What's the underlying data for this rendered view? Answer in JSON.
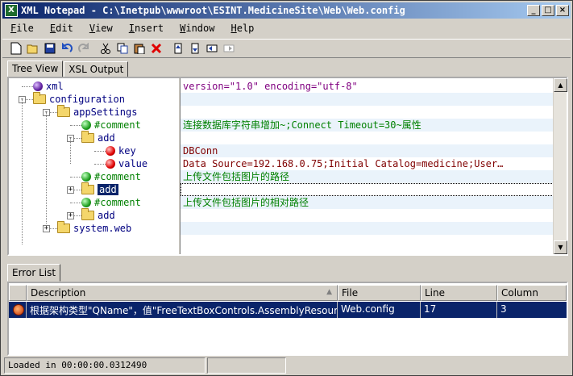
{
  "window": {
    "title": "XML Notepad - C:\\Inetpub\\wwwroot\\ESINT.MedicineSite\\Web\\Web.config",
    "app_icon": "X"
  },
  "menu": [
    "File",
    "Edit",
    "View",
    "Insert",
    "Window",
    "Help"
  ],
  "toolbar": {
    "icons": [
      "new-icon",
      "open-icon",
      "save-icon",
      "undo-icon",
      "redo-icon",
      "cut-icon",
      "copy-icon",
      "paste-icon",
      "delete-icon",
      "nudge-up-icon",
      "nudge-down-icon",
      "nudge-left-icon",
      "nudge-right-icon"
    ]
  },
  "tabs": [
    "Tree View",
    "XSL Output"
  ],
  "tree": [
    {
      "label": "xml",
      "icon": "purple-ball",
      "depth": 0,
      "exp": ""
    },
    {
      "label": "configuration",
      "icon": "folder",
      "depth": 0,
      "exp": "-"
    },
    {
      "label": "appSettings",
      "icon": "folder",
      "depth": 1,
      "exp": "-"
    },
    {
      "label": "#comment",
      "icon": "green-ball",
      "depth": 2,
      "exp": ""
    },
    {
      "label": "add",
      "icon": "folder",
      "depth": 2,
      "exp": "-"
    },
    {
      "label": "key",
      "icon": "red-ball",
      "depth": 3,
      "exp": ""
    },
    {
      "label": "value",
      "icon": "red-ball",
      "depth": 3,
      "exp": ""
    },
    {
      "label": "#comment",
      "icon": "green-ball",
      "depth": 2,
      "exp": ""
    },
    {
      "label": "add",
      "icon": "folder",
      "depth": 2,
      "exp": "+",
      "selected": true
    },
    {
      "label": "#comment",
      "icon": "green-ball",
      "depth": 2,
      "exp": ""
    },
    {
      "label": "add",
      "icon": "folder",
      "depth": 2,
      "exp": "+"
    },
    {
      "label": "system.web",
      "icon": "folder",
      "depth": 1,
      "exp": "+"
    }
  ],
  "values": [
    {
      "text": "version=\"1.0\" encoding=\"utf-8\"",
      "kind": "pi"
    },
    {
      "text": "",
      "kind": ""
    },
    {
      "text": "",
      "kind": ""
    },
    {
      "text": "连接数据库字符串增加~;Connect Timeout=30~属性",
      "kind": "cm"
    },
    {
      "text": "",
      "kind": ""
    },
    {
      "text": "DBConn",
      "kind": "txt"
    },
    {
      "text": "Data Source=192.168.0.75;Initial Catalog=medicine;User…",
      "kind": "txt"
    },
    {
      "text": "上传文件包括图片的路径",
      "kind": "cm"
    },
    {
      "text": "",
      "kind": "",
      "focus": true
    },
    {
      "text": "上传文件包括图片的相对路径",
      "kind": "cm"
    },
    {
      "text": "",
      "kind": ""
    },
    {
      "text": "",
      "kind": ""
    }
  ],
  "error_list": {
    "tab_label": "Error List",
    "columns": [
      "Description",
      "File",
      "Line",
      "Column"
    ],
    "rows": [
      {
        "description": "根据架构类型\"QName\"，值\"FreeTextBoxControls.AssemblyResourc...",
        "file": "Web.config",
        "line": "17",
        "column": "3"
      }
    ]
  },
  "status": {
    "text": "Loaded in 00:00:00.0312490",
    "panel2": ""
  }
}
